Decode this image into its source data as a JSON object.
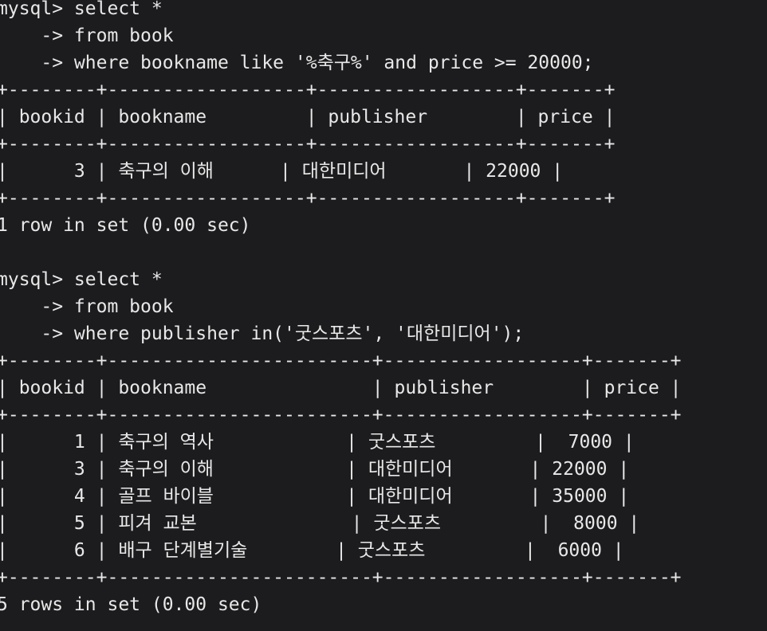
{
  "terminal": {
    "foreground": "#e8e8e8",
    "background": "#1c1c1e",
    "lines": [
      "mysql> select *",
      "    -> from book",
      "    -> where bookname like '%축구%' and price >= 20000;",
      "+--------+------------------+------------------+-------+",
      "| bookid | bookname         | publisher        | price |",
      "+--------+------------------+------------------+-------+",
      "|      3 | 축구의 이해      | 대한미디어       | 22000 |",
      "+--------+------------------+------------------+-------+",
      "1 row in set (0.00 sec)",
      "",
      "mysql> select *",
      "    -> from book",
      "    -> where publisher in('굿스포츠', '대한미디어');",
      "+--------+------------------------+------------------+-------+",
      "| bookid | bookname               | publisher        | price |",
      "+--------+------------------------+------------------+-------+",
      "|      1 | 축구의 역사            | 굿스포츠         |  7000 |",
      "|      3 | 축구의 이해            | 대한미디어       | 22000 |",
      "|      4 | 골프 바이블            | 대한미디어       | 35000 |",
      "|      5 | 피겨 교본              | 굿스포츠         |  8000 |",
      "|      6 | 배구 단계별기술        | 굿스포츠         |  6000 |",
      "+--------+------------------------+------------------+-------+",
      "5 rows in set (0.00 sec)"
    ]
  }
}
